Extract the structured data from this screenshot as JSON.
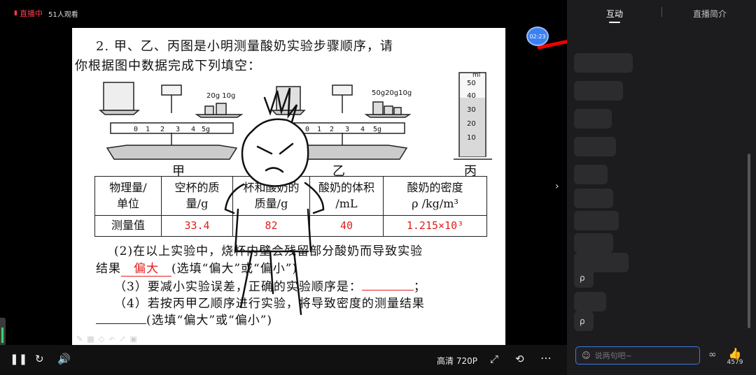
{
  "live": {
    "badge": "直播中",
    "viewers": "51人观看",
    "timer": "02:23"
  },
  "question": {
    "line1": "2. 甲、乙、丙图是小明测量酸奶实验步骤顺序，请",
    "line2": "你根据图中数据完成下列填空：",
    "figure_labels": [
      "甲",
      "乙",
      "丙"
    ],
    "scale_a_marks": [
      "0",
      "1",
      "2",
      "3",
      "4",
      "5g"
    ],
    "scale_a_weights": "20g 10g",
    "scale_b_marks": [
      "0",
      "1",
      "2",
      "3",
      "4",
      "5g"
    ],
    "scale_b_weights": "50g20g10g",
    "cylinder_unit": "ml",
    "cylinder_marks": [
      "50",
      "40",
      "30",
      "20",
      "10"
    ],
    "table": {
      "headers": [
        [
          "物理量/",
          "单位"
        ],
        [
          "空杯的质",
          "量/g"
        ],
        [
          "杯和酸奶的",
          "质量/g"
        ],
        [
          "酸奶的体积",
          "/mL"
        ],
        [
          "酸奶的密度",
          "ρ /kg/m³"
        ]
      ],
      "row_label": "测量值",
      "values": [
        "33.4",
        "82",
        "40",
        "1.215×10³"
      ]
    },
    "q2_line1": "(2)在以上实验中，烧杯内壁会残留部分酸奶而导致实验",
    "q2_prefix": "结果",
    "q2_answer": "偏大",
    "q2_suffix": "(选填“偏大”或“偏小”)",
    "q3": "（3）要减小实验误差，正确的实验顺序是：",
    "q3_end": "；",
    "q4_line1": "（4）若按丙甲乙顺序进行实验，将导致密度的测量结果",
    "q4_suffix": "(选填“偏大”或“偏小”)"
  },
  "controls": {
    "quality": "高清 720P"
  },
  "panel": {
    "tab_interact": "互动",
    "tab_intro": "直播简介",
    "messages": [
      "",
      "",
      "",
      "",
      "",
      "",
      "",
      "",
      "",
      "ρ",
      "",
      "ρ"
    ],
    "input_placeholder": "说两句吧~",
    "like_count": "4579"
  },
  "colors": {
    "accent": "#3d7bd9",
    "live_red": "#ff3b4e",
    "answer_red": "#e02020",
    "scribble_red": "#ff0000"
  }
}
